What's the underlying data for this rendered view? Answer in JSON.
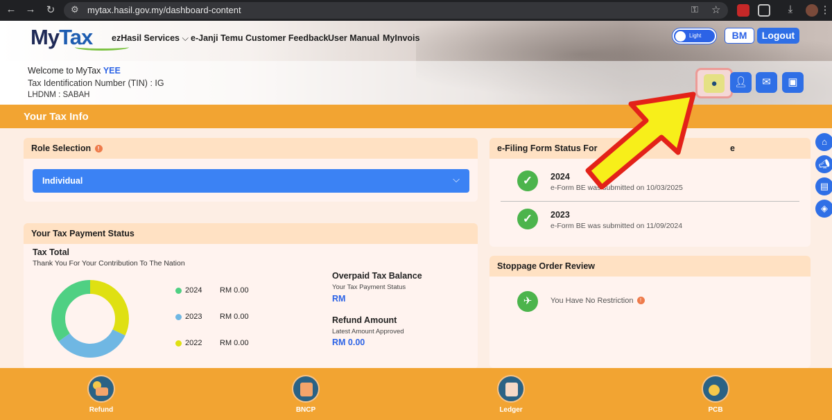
{
  "browser": {
    "url": "mytax.hasil.gov.my/dashboard-content"
  },
  "header": {
    "logo_my": "My",
    "logo_tax": "Tax",
    "nav": [
      "ezHasil Services",
      "e-Janji Temu",
      "Customer Feedback",
      "User Manual",
      "MyInvois"
    ],
    "theme_toggle_label": "Light",
    "language_button": "BM",
    "logout_button": "Logout",
    "welcome_prefix": "Welcome to MyTax",
    "user_name": "YEE",
    "tin_line": "Tax Identification Number (TIN) : IG",
    "lhdnm_line": "LHDNM : SABAH"
  },
  "section_title": "Your Tax Info",
  "role_selection": {
    "title": "Role Selection",
    "selected": "Individual"
  },
  "tax_payment_status": {
    "title": "Your Tax Payment Status",
    "tax_total_label": "Tax Total",
    "thanks_text": "Thank You For Your Contribution To The Nation",
    "legend": [
      {
        "year": "2024",
        "amount": "RM 0.00",
        "color": "#4fd083"
      },
      {
        "year": "2023",
        "amount": "RM 0.00",
        "color": "#6fb7e3"
      },
      {
        "year": "2022",
        "amount": "RM 0.00",
        "color": "#dfe012"
      }
    ],
    "donut_shares": [
      0.35,
      0.33,
      0.32
    ],
    "overpaid_title": "Overpaid Tax Balance",
    "overpaid_sub": "Your Tax Payment Status",
    "overpaid_value": "RM",
    "refund_title": "Refund Amount",
    "refund_sub": "Latest Amount Approved",
    "refund_value": "RM 0.00"
  },
  "efiling": {
    "title": "e-Filing Form Status For",
    "title_hidden_suffix": "e",
    "entries": [
      {
        "year": "2024",
        "status": "e-Form BE was submitted on 10/03/2025"
      },
      {
        "year": "2023",
        "status": "e-Form BE was submitted on 11/09/2024"
      }
    ]
  },
  "stoppage": {
    "title": "Stoppage Order Review",
    "status": "You Have No Restriction"
  },
  "footer": [
    {
      "label": "Refund",
      "icon": "refund-icon"
    },
    {
      "label": "BNCP",
      "icon": "bncp-icon"
    },
    {
      "label": "Ledger",
      "icon": "ledger-icon"
    },
    {
      "label": "PCB",
      "icon": "pcb-icon"
    }
  ],
  "colors": {
    "orange": "#f2a432",
    "blue": "#2f6fe6",
    "green": "#4cb44c",
    "highlight_arrow": "#f7ef1a",
    "highlight_outline": "#e32219"
  }
}
